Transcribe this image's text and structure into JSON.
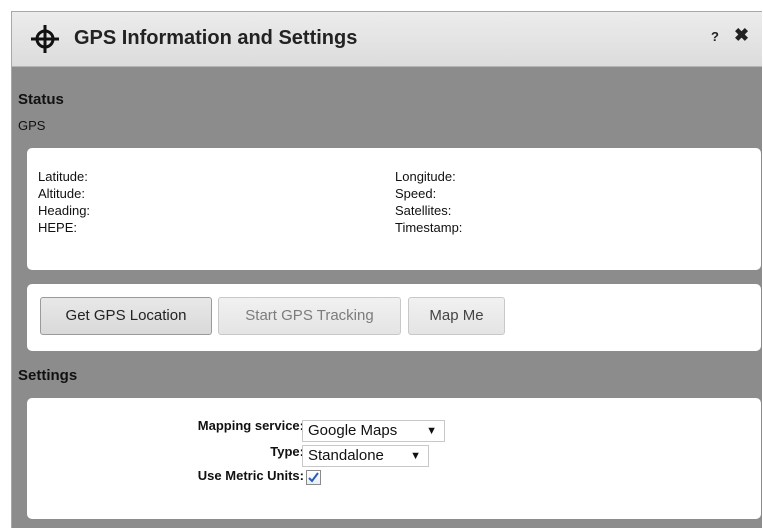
{
  "dialog": {
    "title": "GPS Information and Settings",
    "help_label": "?",
    "close_label": "✖"
  },
  "status": {
    "heading": "Status",
    "subheading": "GPS",
    "fields": {
      "latitude": "Latitude:",
      "altitude": "Altitude:",
      "heading": "Heading:",
      "hepe": "HEPE:",
      "longitude": "Longitude:",
      "speed": "Speed:",
      "satellites": "Satellites:",
      "timestamp": "Timestamp:"
    }
  },
  "actions": {
    "get_location": "Get GPS Location",
    "start_tracking": "Start GPS Tracking",
    "map_me": "Map Me"
  },
  "settings": {
    "heading": "Settings",
    "mapping_service_label": "Mapping service:",
    "mapping_service_value": "Google Maps",
    "type_label": "Type:",
    "type_value": "Standalone",
    "metric_label": "Use Metric Units:",
    "metric_checked": true
  },
  "icons": {
    "title_icon": "crosshair-icon",
    "caret": "chevron-down-icon",
    "check": "checkmark-icon"
  },
  "colors": {
    "dialog_background": "#8c8c8c",
    "titlebar": "#e4e4e4",
    "panel": "#ffffff",
    "checkmark": "#2a5db0"
  }
}
